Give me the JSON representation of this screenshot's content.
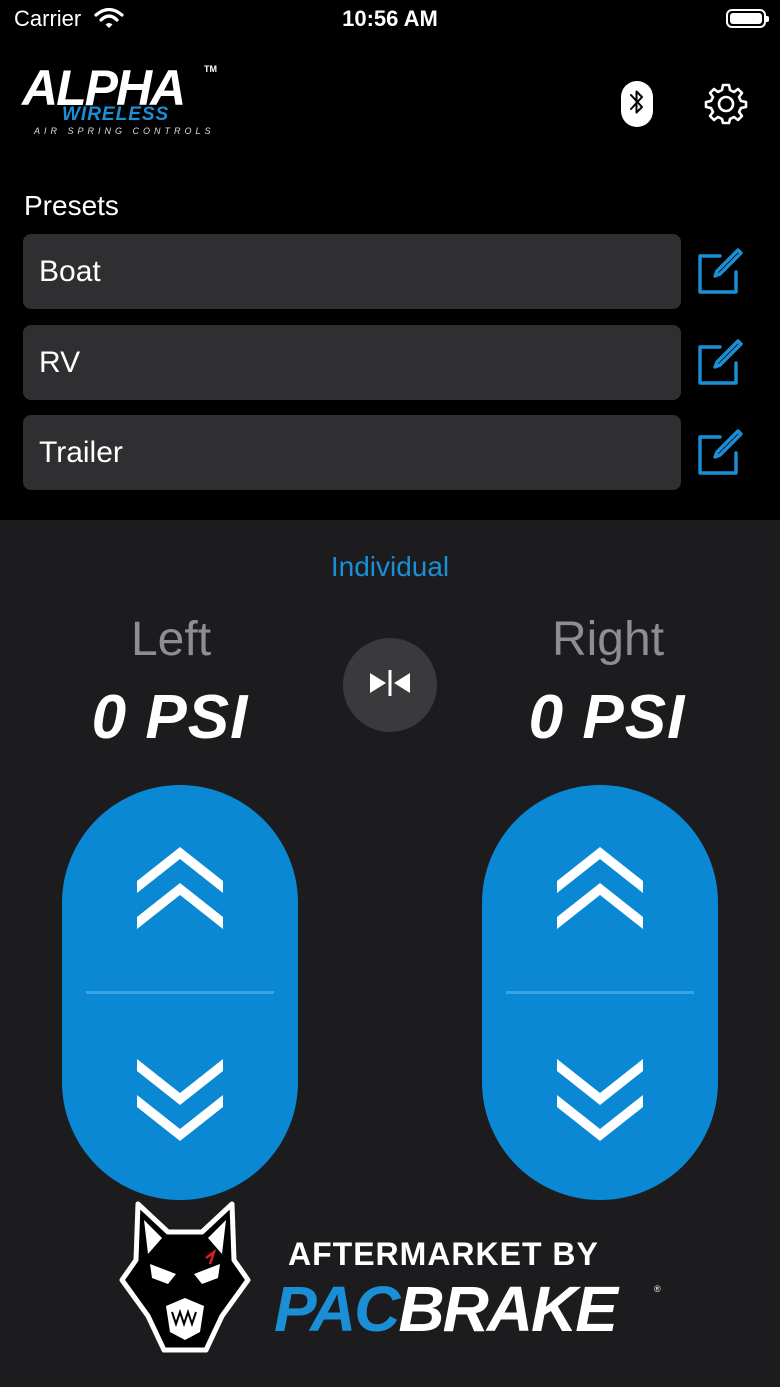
{
  "status_bar": {
    "carrier": "Carrier",
    "time": "10:56 AM"
  },
  "logo": {
    "main": "ALPHA",
    "tm": "TM",
    "wireless": "WIRELESS",
    "subtitle": "AIR SPRING CONTROLS"
  },
  "header_icons": [
    "bluetooth-icon",
    "gear-icon"
  ],
  "presets": {
    "title": "Presets",
    "items": [
      {
        "label": "Boat"
      },
      {
        "label": "RV"
      },
      {
        "label": "Trailer"
      }
    ]
  },
  "control": {
    "mode_label": "Individual",
    "left": {
      "label": "Left",
      "pressure": "0 PSI"
    },
    "right": {
      "label": "Right",
      "pressure": "0 PSI"
    }
  },
  "footer": {
    "aftermarket": "AFTERMARKET BY",
    "brand_part1": "PAC",
    "brand_part2": "BRAKE",
    "registered": "®"
  },
  "colors": {
    "accent": "#1a8fd6",
    "pill": "#0a88d4",
    "panel_bg": "#1c1c1e",
    "preset_bg": "#2f2f31"
  }
}
